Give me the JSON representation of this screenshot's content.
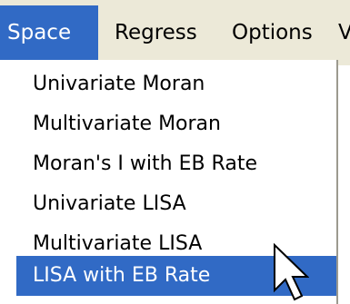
{
  "menubar": {
    "items": [
      {
        "label": "Space"
      },
      {
        "label": "Regress"
      },
      {
        "label": "Options"
      },
      {
        "label": "V"
      }
    ],
    "active_index": 0
  },
  "space_menu": {
    "items": [
      {
        "label": "Univariate Moran"
      },
      {
        "label": "Multivariate Moran"
      },
      {
        "label": "Moran's I with EB Rate"
      },
      {
        "label": "Univariate LISA"
      },
      {
        "label": "Multivariate LISA"
      },
      {
        "label": "LISA with EB Rate"
      }
    ],
    "highlighted_index": 5
  },
  "colors": {
    "menubar_bg": "#ece9d8",
    "highlight": "#316ac5",
    "highlight_text": "#ffffff",
    "menu_bg": "#ffffff"
  },
  "icons": {
    "cursor": "arrow-cursor-icon"
  }
}
